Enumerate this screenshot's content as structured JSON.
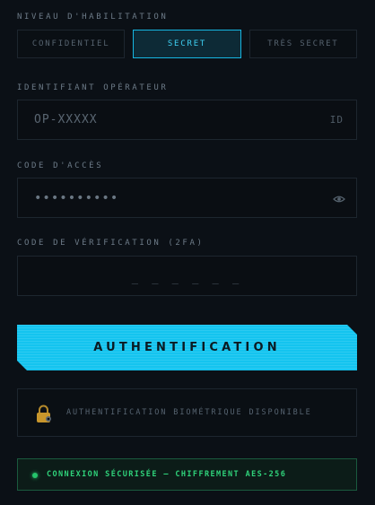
{
  "clearance": {
    "label": "NIVEAU D'HABILITATION",
    "options": [
      "CONFIDENTIEL",
      "SECRET",
      "TRÈS SECRET"
    ],
    "selected": "SECRET"
  },
  "operator_id": {
    "label": "IDENTIFIANT OPÉRATEUR",
    "placeholder": "OP-XXXXX",
    "suffix": "ID"
  },
  "access_code": {
    "label": "CODE D'ACCÈS",
    "value": "••••••••••",
    "icon": "eye-icon"
  },
  "verification": {
    "label": "CODE DE VÉRIFICATION (2FA)",
    "placeholder": "_ _ _ _ _ _"
  },
  "auth_button": {
    "label": "AUTHENTIFICATION"
  },
  "biometric": {
    "icon": "lock-icon",
    "text": "AUTHENTIFICATION BIOMÉTRIQUE DISPONIBLE"
  },
  "status": {
    "text": "CONNEXION SÉCURISÉE — CHIFFREMENT AES-256"
  },
  "colors": {
    "background": "#0b1016",
    "accent": "#14c4ef",
    "status_green": "#2fd27a"
  }
}
